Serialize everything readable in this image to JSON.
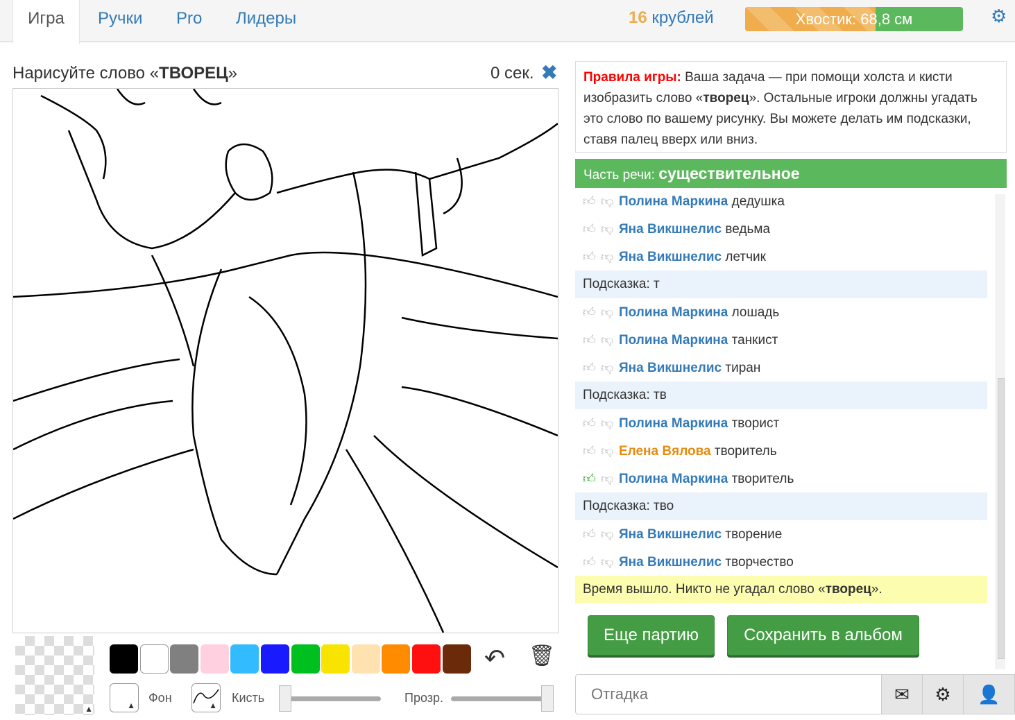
{
  "nav": {
    "tabs": [
      {
        "label": "Игра"
      },
      {
        "label": "Ручки"
      },
      {
        "label": "Pro"
      },
      {
        "label": "Лидеры"
      }
    ],
    "coins_amount": "16",
    "coins_unit": "крублей",
    "tail_label": "Хвостик: 68,8 см",
    "tail_progress_percent": 60
  },
  "game": {
    "prompt_prefix": "Нарисуйте слово «",
    "word": "ТВОРЕЦ",
    "prompt_suffix": "»",
    "timer": "0 сек."
  },
  "palette": {
    "colors": [
      "#000000",
      "#ffffff",
      "#808080",
      "#ffd0e0",
      "#33bbff",
      "#1a1aff",
      "#00c020",
      "#f8e400",
      "#ffe2b0",
      "#ff8c00",
      "#ff1010",
      "#6b2a0a"
    ]
  },
  "tools": {
    "bg_label": "Фон",
    "brush_label": "Кисть",
    "opacity_label": "Прозр.",
    "brush_size_percent": 0,
    "opacity_percent": 100
  },
  "rules": {
    "title": "Правила игры:",
    "text": " Ваша задача — при помощи холста и кисти изобразить слово «",
    "word": "творец",
    "text2": "». Остальные игроки должны угадать это слово по вашему рисунку. Вы можете делать им подсказки, ставя палец вверх или вниз."
  },
  "part_of_speech": {
    "label": "Часть речи: ",
    "value": "существительное"
  },
  "chat": [
    {
      "name": "Полина Маркина",
      "guess": "дедушка"
    },
    {
      "name": "Яна Викшнелис",
      "guess": "ведьма"
    },
    {
      "name": "Яна Викшнелис",
      "guess": "летчик"
    },
    {
      "hint_label": "Подсказка",
      "hint": ": т"
    },
    {
      "name": "Полина Маркина",
      "guess": "лошадь"
    },
    {
      "name": "Полина Маркина",
      "guess": "танкист"
    },
    {
      "name": "Яна Викшнелис",
      "guess": "тиран"
    },
    {
      "hint_label": "Подсказка",
      "hint": ": тв"
    },
    {
      "name": "Полина Маркина",
      "guess": "творист"
    },
    {
      "name": "Елена Вялова",
      "guess": "творитель",
      "orange": true
    },
    {
      "name": "Полина Маркина",
      "guess": "творитель",
      "liked": true
    },
    {
      "hint_label": "Подсказка",
      "hint": ": тво"
    },
    {
      "name": "Яна Викшнелис",
      "guess": "творение"
    },
    {
      "name": "Яна Викшнелис",
      "guess": "творчество"
    }
  ],
  "result": {
    "text": "Время вышло. Никто не угадал слово «",
    "word": "творец",
    "end": "»."
  },
  "buttons": {
    "again": "Еще партию",
    "save": "Сохранить в альбом"
  },
  "input": {
    "placeholder": "Отгадка"
  }
}
